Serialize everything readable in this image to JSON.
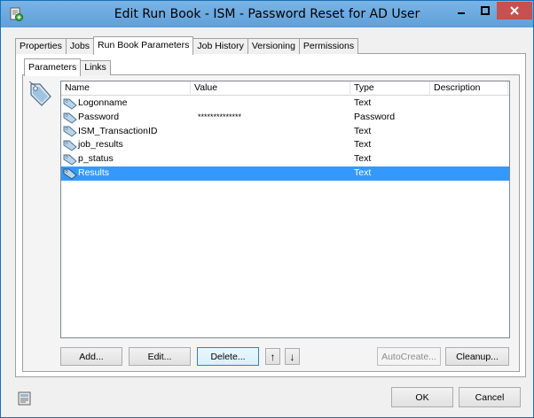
{
  "window": {
    "title": "Edit Run Book - ISM - Password Reset for AD User"
  },
  "tabs": [
    {
      "label": "Properties"
    },
    {
      "label": "Jobs"
    },
    {
      "label": "Run Book Parameters"
    },
    {
      "label": "Job History"
    },
    {
      "label": "Versioning"
    },
    {
      "label": "Permissions"
    }
  ],
  "subtabs": [
    {
      "label": "Parameters"
    },
    {
      "label": "Links"
    }
  ],
  "list": {
    "columns": [
      "Name",
      "Value",
      "Type",
      "Description"
    ],
    "rows": [
      {
        "name": "Logonname",
        "value": "",
        "type": "Text",
        "description": ""
      },
      {
        "name": "Password",
        "value": "**************",
        "type": "Password",
        "description": ""
      },
      {
        "name": "ISM_TransactionID",
        "value": "",
        "type": "Text",
        "description": ""
      },
      {
        "name": "job_results",
        "value": "",
        "type": "Text",
        "description": ""
      },
      {
        "name": "p_status",
        "value": "",
        "type": "Text",
        "description": ""
      },
      {
        "name": "Results",
        "value": "",
        "type": "Text",
        "description": ""
      }
    ]
  },
  "buttons": {
    "add": "Add...",
    "edit": "Edit...",
    "delete": "Delete...",
    "move_up": "↑",
    "move_down": "↓",
    "autocreate": "AutoCreate...",
    "cleanup": "Cleanup...",
    "ok": "OK",
    "cancel": "Cancel"
  },
  "colors": {
    "titlebar": "#6fa8dc",
    "selection": "#3399ff",
    "close_button": "#c75050"
  },
  "icons": {
    "title": "runbook-icon",
    "parameter": "parameter-tag-icon",
    "bottom": "properties-icon"
  }
}
